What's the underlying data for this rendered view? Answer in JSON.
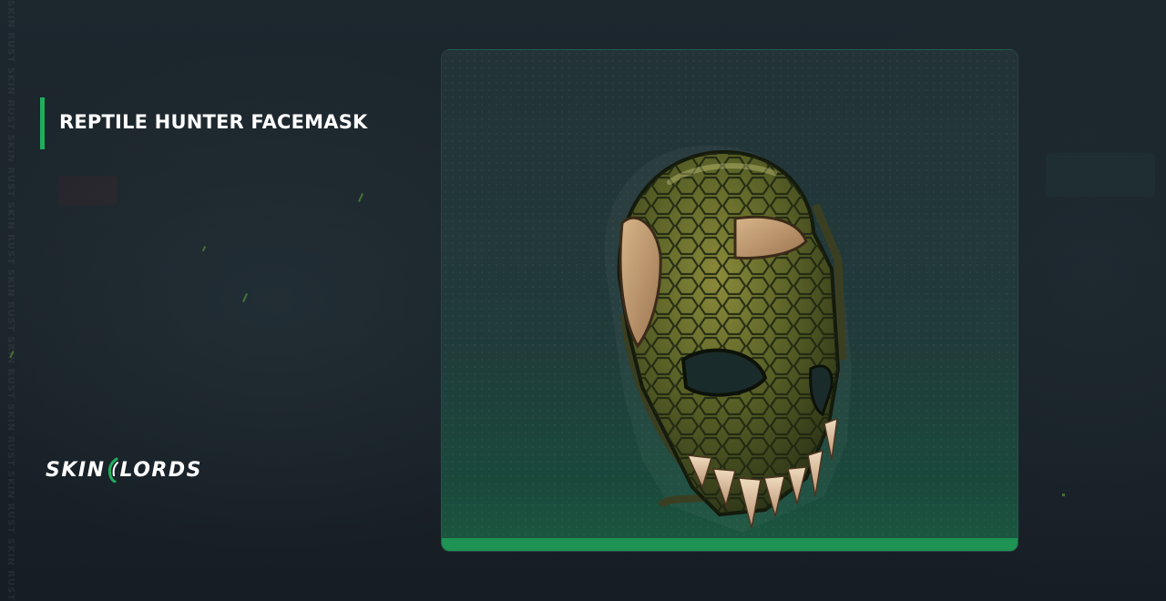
{
  "item": {
    "title": "REPTILE HUNTER FACEMASK"
  },
  "brand": {
    "name_left": "SKIN",
    "name_right": "LORDS",
    "accent_color": "#1fae5c"
  },
  "side_watermark": "SKIN RUST SKIN RUST SKIN RUST SKIN RUST SKIN RUST SKIN RUST SKIN RUST SKIN RUST SKIN RUST SKIN RUST",
  "card": {
    "bottom_bar_color": "#1e9354"
  },
  "icons": {
    "item_image": "reptile-hunter-facemask-image",
    "logo_mark": "skinlords-logo-mark"
  }
}
